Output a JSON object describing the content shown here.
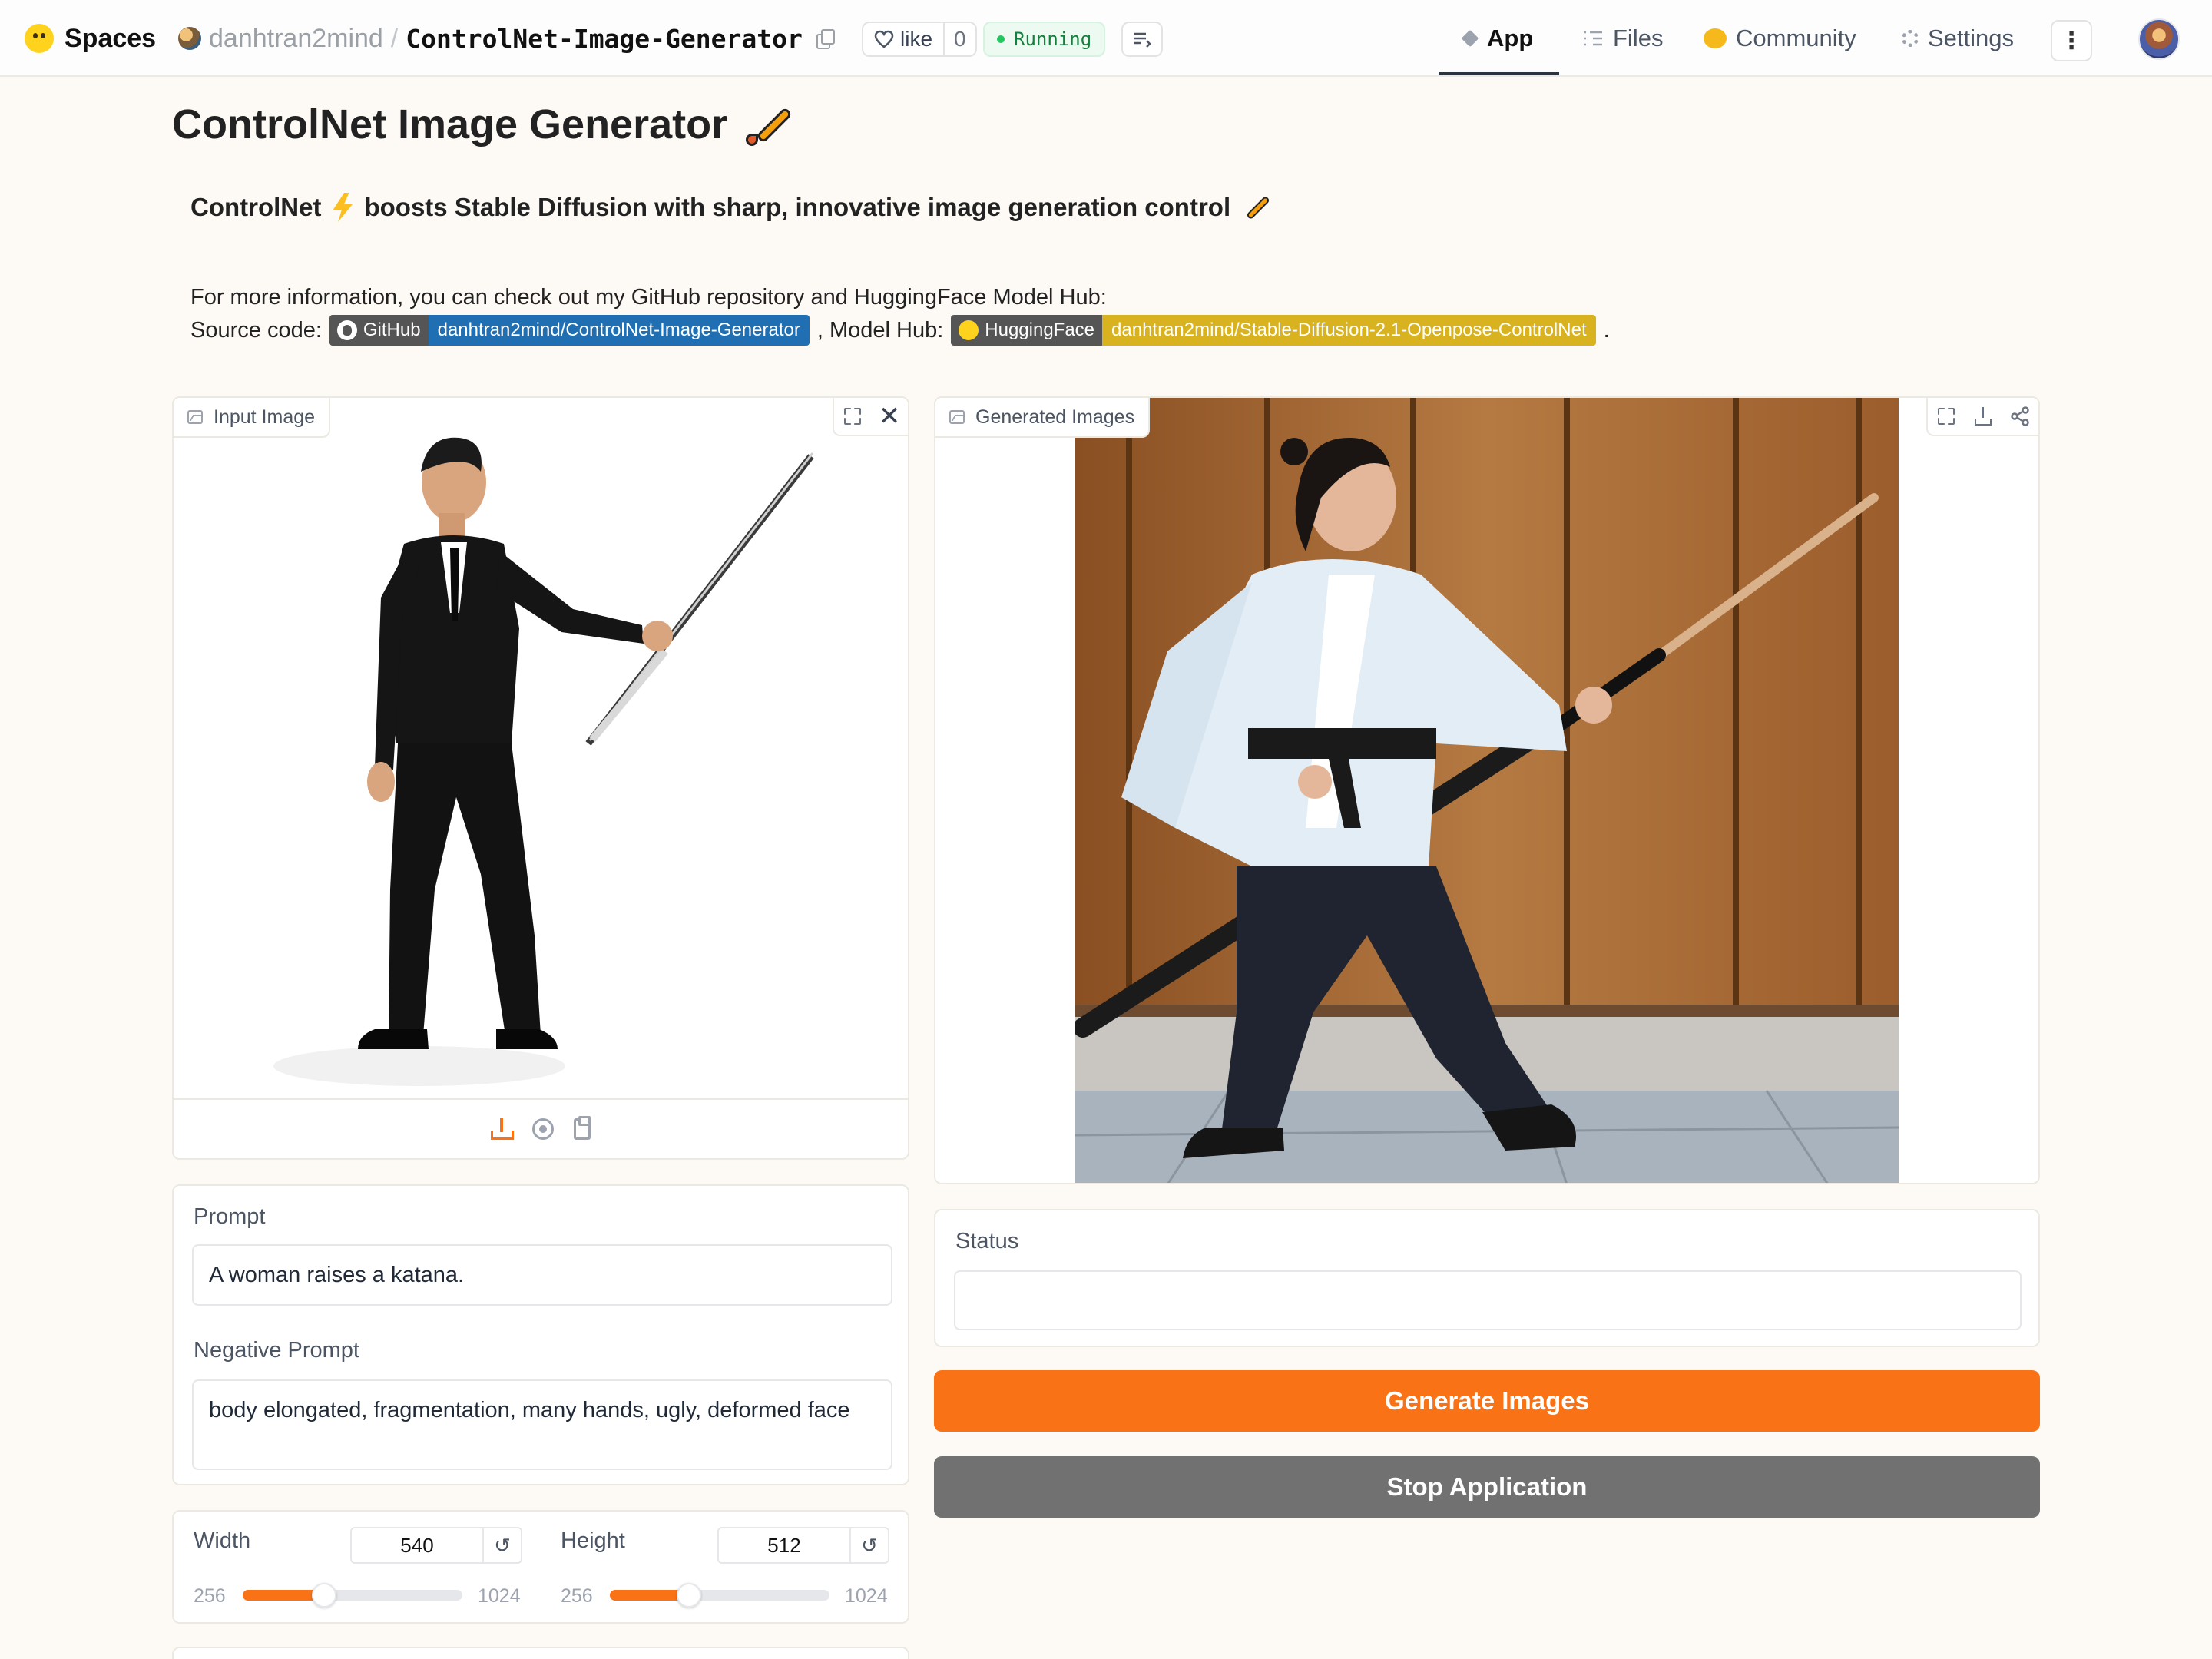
{
  "nav": {
    "brand": "Spaces",
    "owner": "danhtran2mind",
    "separator": "/",
    "repo_name": "ControlNet-Image-Generator",
    "like_label": "like",
    "like_count": "0",
    "status": "Running",
    "tabs": [
      {
        "label": "App",
        "icon": "cube-icon",
        "active": true
      },
      {
        "label": "Files",
        "icon": "files-icon"
      },
      {
        "label": "Community",
        "icon": "community-icon"
      },
      {
        "label": "Settings",
        "icon": "gear-icon"
      }
    ],
    "more_glyph": "⋮"
  },
  "page": {
    "title": "ControlNet Image Generator",
    "subtitle_start": "ControlNet",
    "subtitle_rest": "boosts Stable Diffusion with sharp, innovative image generation control",
    "info_line": "For more information, you can check out my GitHub repository and HuggingFace Model Hub:",
    "source_label": "Source code:",
    "github_badge_left": "GitHub",
    "github_badge_right": "danhtran2mind/ControlNet-Image-Generator",
    "model_hub_label": ", Model Hub:",
    "hf_badge_left": "HuggingFace",
    "hf_badge_right": "danhtran2mind/Stable-Diffusion-2.1-Openpose-ControlNet",
    "trailing_dot": "."
  },
  "input_image": {
    "label": "Input Image",
    "close_glyph": "✕"
  },
  "generated": {
    "label": "Generated Images"
  },
  "form": {
    "prompt_label": "Prompt",
    "prompt_value": "A woman raises a katana.",
    "negative_label": "Negative Prompt",
    "negative_value": "body elongated, fragmentation, many hands, ugly, deformed face",
    "width_label": "Width",
    "width_value": "540",
    "width_min": "256",
    "width_max": "1024",
    "width_fraction": 0.37,
    "height_label": "Height",
    "height_value": "512",
    "height_min": "256",
    "height_max": "1024",
    "height_fraction": 0.36,
    "reset_glyph": "↺"
  },
  "status": {
    "label": "Status",
    "value": ""
  },
  "buttons": {
    "generate": "Generate Images",
    "stop": "Stop Application"
  },
  "colors": {
    "accent": "#f97316",
    "running": "#15803d",
    "github_badge": "#1f6fb2",
    "hf_badge": "#d8b21f",
    "stop_button": "#717171"
  }
}
